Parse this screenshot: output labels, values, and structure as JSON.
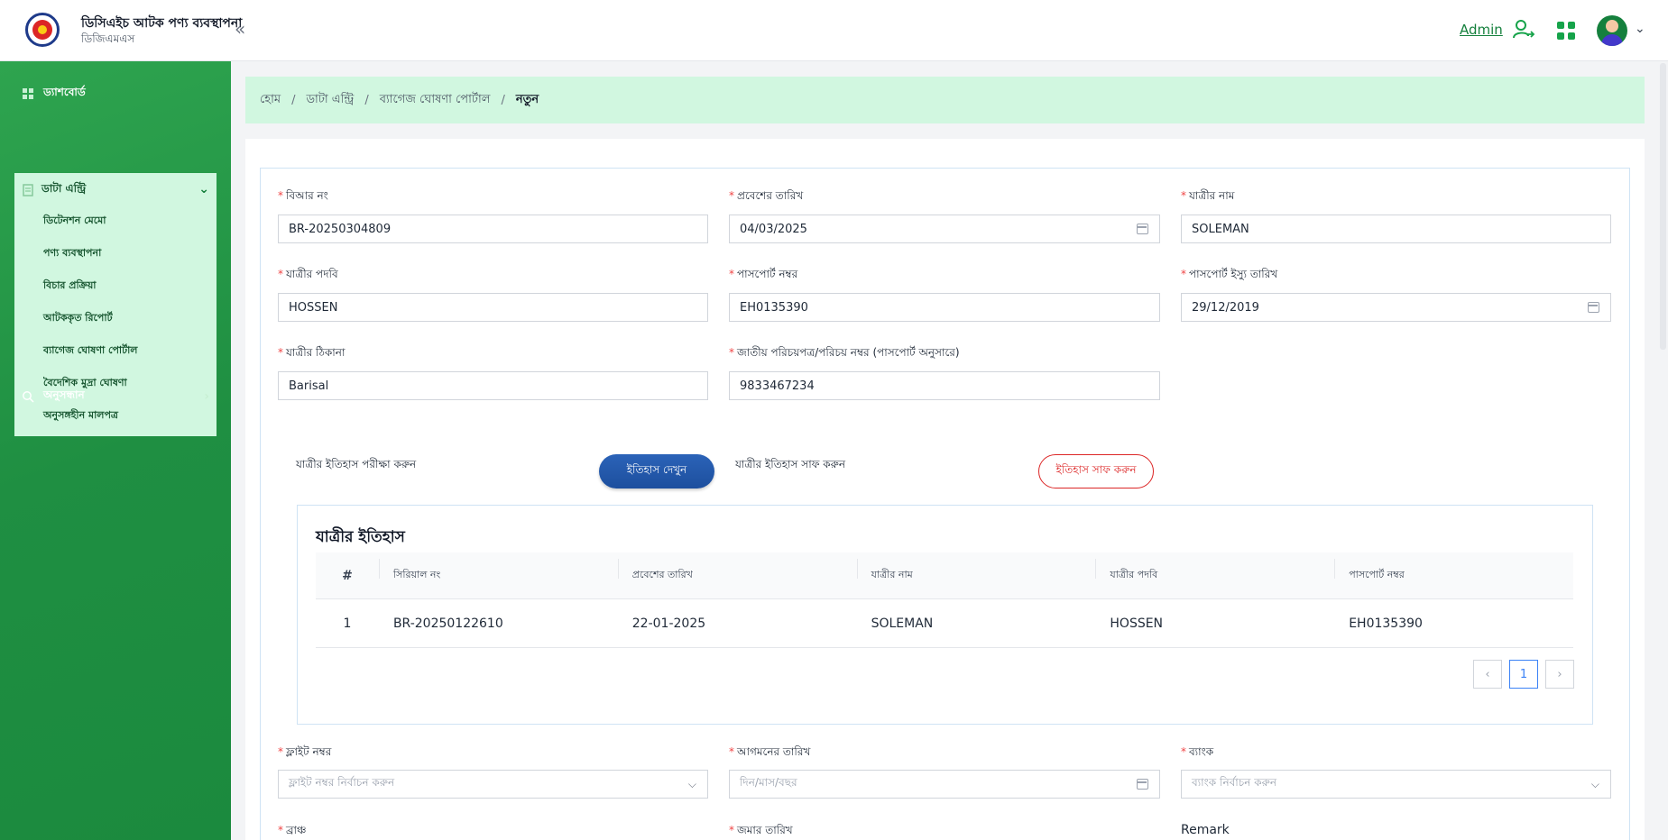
{
  "header": {
    "title": "ডিসিএইচ আটক পণ্য ব্যবস্থাপনা",
    "subtitle": "ডিজিএমএস",
    "collapse_glyph": "«",
    "admin_label": "Admin",
    "caret": "⌄"
  },
  "sidebar": {
    "dashboard": "ড্যাশবোর্ড",
    "data_entry": "ডাটা এন্ট্রি",
    "chevron_down": "⌄",
    "chevron_right": "›",
    "items": [
      "ডিটেনশন মেমো",
      "পণ্য ব্যবস্থাপনা",
      "বিচার প্রক্রিয়া",
      "আটককৃত রিপোর্ট",
      "ব্যাগেজ ঘোষণা পোর্টাল",
      "বৈদেশিক মুদ্রা ঘোষণা",
      "অনুসঙ্গহীন মালপত্র"
    ],
    "search": "অনুসন্ধান"
  },
  "breadcrumb": {
    "home": "হোম",
    "data_entry": "ডাটা এন্ট্রি",
    "portal": "ব্যাগেজ ঘোষণা পোর্টাল",
    "current": "নতুন",
    "sep": "/"
  },
  "form": {
    "required_mark": "*",
    "br_no": {
      "label": "বিআর নং",
      "value": "BR-20250304809"
    },
    "entry_date": {
      "label": "প্রবেশের তারিখ",
      "value": "04/03/2025"
    },
    "passenger_name": {
      "label": "যাত্রীর নাম",
      "value": "SOLEMAN"
    },
    "passenger_title": {
      "label": "যাত্রীর পদবি",
      "value": "HOSSEN"
    },
    "passport_no": {
      "label": "পাসপোর্ট নম্বর",
      "value": "EH0135390"
    },
    "passport_issue": {
      "label": "পাসপোর্ট ইস্যু তারিখ",
      "value": "29/12/2019"
    },
    "address": {
      "label": "যাত্রীর ঠিকানা",
      "value": "Barisal"
    },
    "nid": {
      "label": "জাতীয় পরিচয়পত্র/পরিচয় নম্বর (পাসপোর্ট অনুসারে)",
      "value": "9833467234"
    },
    "flight_no": {
      "label": "ফ্লাইট নম্বর",
      "placeholder": "ফ্লাইট নম্বর নির্বাচন করুন"
    },
    "arrival_date": {
      "label": "আগমনের তারিখ",
      "placeholder": "দিন/মাস/বছর"
    },
    "bank": {
      "label": "ব্যাংক",
      "placeholder": "ব্যাংক নির্বাচন করুন"
    },
    "branch": {
      "label": "ব্রাঞ্চ"
    },
    "deposit_date": {
      "label": "জমার তারিখ"
    },
    "remark": {
      "label": "Remark"
    }
  },
  "history_actions": {
    "check_label": "যাত্রীর ইতিহাস পরীক্ষা করুন",
    "view_button": "ইতিহাস দেখুন",
    "clear_label": "যাত্রীর ইতিহাস সাফ করুন",
    "clear_button": "ইতিহাস সাফ করুন"
  },
  "history": {
    "title": "যাত্রীর ইতিহাস",
    "columns": [
      "#",
      "সিরিয়াল নং",
      "প্রবেশের তারিখ",
      "যাত্রীর নাম",
      "যাত্রীর পদবি",
      "পাসপোর্ট নম্বর"
    ],
    "rows": [
      [
        "1",
        "BR-20250122610",
        "22-01-2025",
        "SOLEMAN",
        "HOSSEN",
        "EH0135390"
      ]
    ],
    "pager": {
      "prev": "‹",
      "page": "1",
      "next": "›"
    }
  },
  "colors": {
    "sidebar_green": "#1f8f42",
    "breadcrumb_bg": "#d1f7e0",
    "primary_blue": "#1d4f9e",
    "danger_red": "#dc2626",
    "required_red": "#ef4444"
  }
}
